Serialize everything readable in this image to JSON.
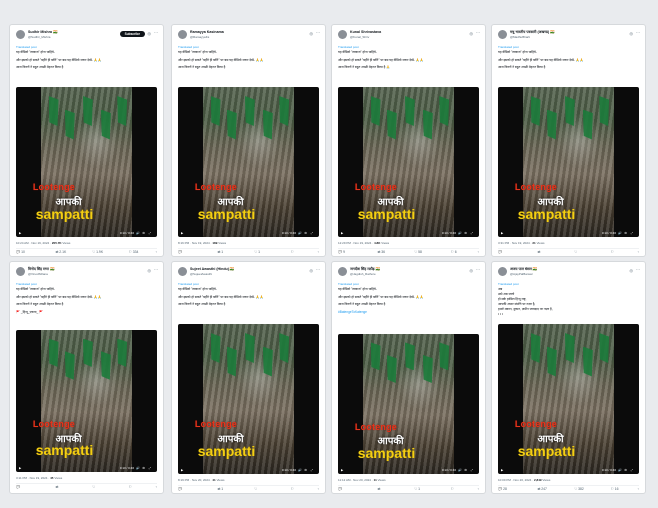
{
  "cards": [
    {
      "name": "Sudhir Mishra 🇮🇳",
      "handle": "@Sudhir_Mishra",
      "has_subscribe": true,
      "subscribe_label": "Subscribe",
      "translated": "Translated post",
      "lines": [
        "यह वीडियो \"लव्वाज\" होना चाहिये-",
        "और इसको हो सकते \"बहीरे ही बरीरे\" पर बस यह वीडियो जरूर देखें- 🙏🙏",
        "आज किरणें ने बहुत अच्छी मेहनत किया है"
      ],
      "video_time": "0:13 / 0:46",
      "overlay": [
        "Lootenge",
        "आपकी",
        "sampatti"
      ],
      "meta": {
        "time": "10:24 AM · Nov 19, 2024 ·",
        "views": "205.7K",
        "views_label": "Views"
      },
      "actions": [
        {
          "icon": "reply",
          "count": "10"
        },
        {
          "icon": "retweet",
          "count": "2.1K"
        },
        {
          "icon": "like",
          "count": "1.9K"
        },
        {
          "icon": "bookmark",
          "count": "334"
        }
      ]
    },
    {
      "name": "Ramayya Kasinama",
      "handle": "@RamayyaKs",
      "has_subscribe": false,
      "subscribe_label": "",
      "translated": "Translated post",
      "lines": [
        "यह वीडियो \"लव्वाज\" होना चाहिये-",
        "और इसको हो सकते \"बहीरे ही बरीरे\" पर बस यह वीडियो जरूर देखें- 🙏🙏",
        "आज किरणें ने बहुत अच्छी मेहनत किया है"
      ],
      "video_time": "0:13 / 0:46",
      "overlay": [
        "Lootenge",
        "आपकी",
        "sampatti"
      ],
      "meta": {
        "time": "8:16 PM · Nov 19, 2024 ·",
        "views": "189",
        "views_label": "Views"
      },
      "actions": [
        {
          "icon": "reply",
          "count": ""
        },
        {
          "icon": "retweet",
          "count": "1"
        },
        {
          "icon": "like",
          "count": "1"
        },
        {
          "icon": "bookmark",
          "count": ""
        }
      ]
    },
    {
      "name": "Kunal Shrivastava",
      "handle": "@Kunal_Shriv",
      "has_subscribe": false,
      "subscribe_label": "",
      "translated": "Translated post",
      "lines": [
        "यह वीडियो \"लव्वाज\" होना चाहिये-",
        "और इसको हो सकते \"बहीरे ही बरीरे\" पर बस यह वीडियो जरूर देखें- 🙏🙏",
        "आज किरणें ने बहुत अच्छी मेहनत किया है 🙏"
      ],
      "video_time": "0:13 / 0:46",
      "overlay": [
        "Lootenge",
        "आपकी",
        "sampatti"
      ],
      "meta": {
        "time": "12:29 PM · Nov 19, 2024 ·",
        "views": "4.8K",
        "views_label": "Views"
      },
      "actions": [
        {
          "icon": "reply",
          "count": "9"
        },
        {
          "icon": "retweet",
          "count": "36"
        },
        {
          "icon": "like",
          "count": "58"
        },
        {
          "icon": "bookmark",
          "count": "6"
        }
      ]
    },
    {
      "name": "मधु भारतीय पत्रकारी (अखण्ड) 🇮🇳",
      "handle": "@MadhuBharti",
      "has_subscribe": false,
      "subscribe_label": "",
      "translated": "Translated post",
      "lines": [
        "यह वीडियो \"लव्वाज\" होना चाहिये-",
        "और इसको हो सकते \"बहीरे ही बरीरे\" पर बस यह वीडियो जरूर देखें- 🙏🙏",
        "आज किरणें ने बहुत अच्छी मेहनत किया है"
      ],
      "video_time": "0:13 / 0:46",
      "overlay": [
        "Lootenge",
        "आपकी",
        "sampatti"
      ],
      "meta": {
        "time": "3:31 PM · Nov 19, 2024 ·",
        "views": "21",
        "views_label": "Views"
      },
      "actions": [
        {
          "icon": "reply",
          "count": ""
        },
        {
          "icon": "retweet",
          "count": ""
        },
        {
          "icon": "like",
          "count": ""
        },
        {
          "icon": "bookmark",
          "count": ""
        }
      ]
    },
    {
      "name": "विनोद सिंह राणा 🇮🇳",
      "handle": "@VinodSRana",
      "has_subscribe": false,
      "subscribe_label": "",
      "translated": "Translated post",
      "lines": [
        "यह वीडियो \"लव्वाज\" होना चाहिये-",
        "और इसको हो सकते \"बहीरे ही बरीरे\" पर बस यह वीडियो जरूर देखें- 🙏🙏",
        "आज किरणें ने बहुत अच्छी मेहनत किया है",
        "🚩 _हिन्दू_एकता_ 🚩"
      ],
      "video_time": "0:13 / 0:46",
      "overlay": [
        "Lootenge",
        "आपकी",
        "sampatti"
      ],
      "meta": {
        "time": "3:11 PM · Nov 19, 2024 ·",
        "views": "45",
        "views_label": "Views"
      },
      "actions": [
        {
          "icon": "reply",
          "count": ""
        },
        {
          "icon": "retweet",
          "count": ""
        },
        {
          "icon": "like",
          "count": ""
        },
        {
          "icon": "bookmark",
          "count": ""
        }
      ]
    },
    {
      "name": "Sujeet Awasthi (Hindu) 🇮🇳",
      "handle": "@SujeetAwasthi",
      "has_subscribe": false,
      "subscribe_label": "",
      "translated": "Translated post",
      "lines": [
        "यह वीडियो \"लव्वाज\" होना चाहिये-",
        "और इसको हो सकते \"बहीरे ही बरीरे\" पर बस यह वीडियो जरूर देखें- 🙏🙏",
        "आज किरणें ने बहुत अच्छी मेहनत किया है"
      ],
      "video_time": "0:13 / 0:46",
      "overlay": [
        "Lootenge",
        "आपकी",
        "sampatti"
      ],
      "meta": {
        "time": "8:19 PM · Nov 20, 2024 ·",
        "views": "41",
        "views_label": "Views"
      },
      "actions": [
        {
          "icon": "reply",
          "count": ""
        },
        {
          "icon": "retweet",
          "count": "1"
        },
        {
          "icon": "like",
          "count": ""
        },
        {
          "icon": "bookmark",
          "count": ""
        }
      ]
    },
    {
      "name": "जगदीश सिंह राठौड़ 🇮🇳",
      "handle": "@Jagdish_Rathore",
      "has_subscribe": false,
      "subscribe_label": "",
      "translated": "Translated post",
      "lines": [
        "यह वीडियो \"लव्वाज\" होना चाहिये-",
        "और इसको हो सकते \"बहीरे ही बरीरे\" पर बस यह वीडियो जरूर देखें- 🙏🙏",
        "आज किरणें ने बहुत अच्छी मेहनत किया है"
      ],
      "link_line": "#BatengeToKatenge",
      "video_time": "0:13 / 0:46",
      "overlay": [
        "Lootenge",
        "आपकी",
        "sampatti"
      ],
      "meta": {
        "time": "11:12 AM · Nov 20, 2024 ·",
        "views": "11",
        "views_label": "Views"
      },
      "actions": [
        {
          "icon": "reply",
          "count": ""
        },
        {
          "icon": "retweet",
          "count": ""
        },
        {
          "icon": "like",
          "count": "1"
        },
        {
          "icon": "bookmark",
          "count": ""
        }
      ]
    },
    {
      "name": "अजय पाल बंसल 🇮🇳",
      "handle": "@AjayPalBansal",
      "has_subscribe": false,
      "subscribe_label": "",
      "translated": "Translated post",
      "lines": [
        "अब",
        "उठो अब जागो",
        "हो सके हासिल हिन्दू राष्ट्र,",
        "आपकी अपार संपत्ति पर नज़र है,",
        "हमारे मकान, दुकान, ज़मीन जायदाद पर नज़र है,",
        "• • •"
      ],
      "video_time": "0:13 / 0:46",
      "overlay": [
        "Lootenge",
        "आपकी",
        "sampatti"
      ],
      "meta": {
        "time": "10:00 PM · Nov 20, 2024 ·",
        "views": "2,849",
        "views_label": "Views"
      },
      "actions": [
        {
          "icon": "reply",
          "count": "28"
        },
        {
          "icon": "retweet",
          "count": "247"
        },
        {
          "icon": "like",
          "count": "382"
        },
        {
          "icon": "bookmark",
          "count": "16"
        }
      ]
    }
  ]
}
